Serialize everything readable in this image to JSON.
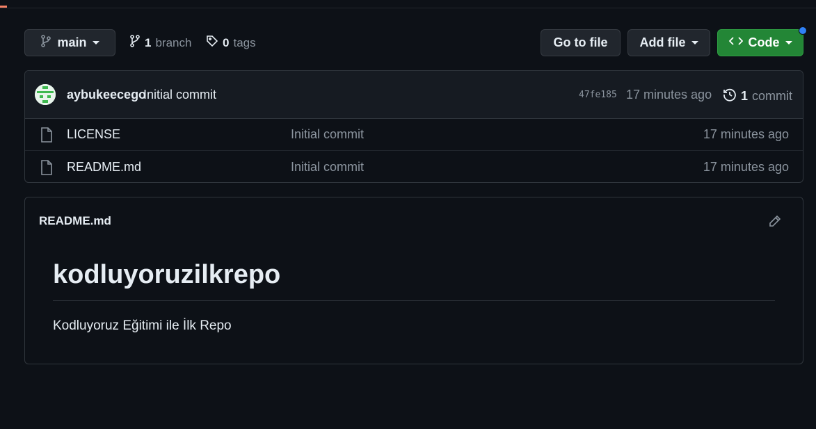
{
  "toolbar": {
    "branch": "main",
    "branches_count": "1",
    "branches_label": "branch",
    "tags_count": "0",
    "tags_label": "tags",
    "go_to_file": "Go to file",
    "add_file": "Add file",
    "code": "Code"
  },
  "latest_commit": {
    "author": "aybukeecego",
    "message": "Initial commit",
    "sha": "47fe185",
    "time": "17 minutes ago",
    "count": "1",
    "count_label": "commit"
  },
  "files": [
    {
      "name": "LICENSE",
      "message": "Initial commit",
      "time": "17 minutes ago"
    },
    {
      "name": "README.md",
      "message": "Initial commit",
      "time": "17 minutes ago"
    }
  ],
  "readme": {
    "filename": "README.md",
    "heading": "kodluyoruzilkrepo",
    "body": "Kodluyoruz Eğitimi ile İlk Repo"
  },
  "icons": {
    "branch": "git-branch-icon",
    "tag": "tag-icon",
    "file": "file-icon",
    "history": "history-icon",
    "edit": "pencil-icon",
    "code": "code-icon"
  },
  "colors": {
    "background": "#0d1117",
    "code_button": "#238636",
    "notification_dot": "#2f81f7"
  }
}
